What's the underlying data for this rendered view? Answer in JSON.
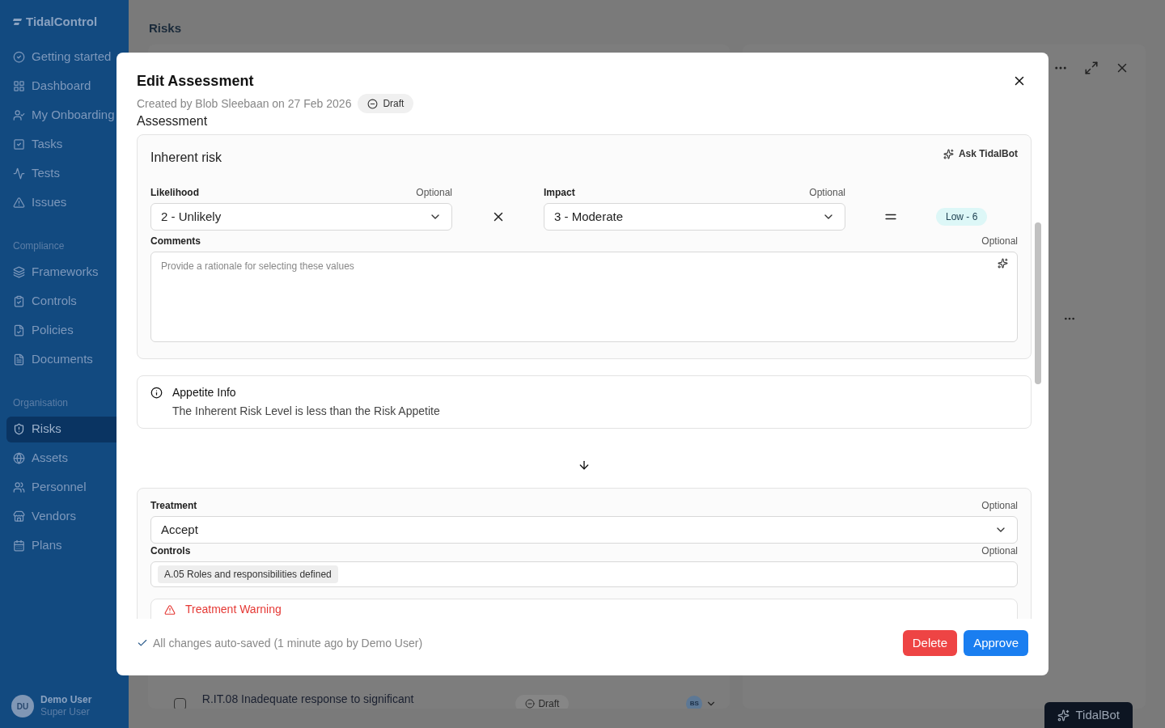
{
  "sidebar": {
    "logo": "TidalControl",
    "groups": [
      {
        "items": [
          {
            "label": "Getting started",
            "selected": false
          },
          {
            "label": "Dashboard",
            "selected": false
          },
          {
            "label": "My Onboarding",
            "selected": false
          },
          {
            "label": "Tasks",
            "selected": false
          },
          {
            "label": "Tests",
            "selected": false
          },
          {
            "label": "Issues",
            "selected": false
          }
        ]
      },
      {
        "heading": "Compliance",
        "items": [
          {
            "label": "Frameworks",
            "selected": false
          },
          {
            "label": "Controls",
            "selected": false
          },
          {
            "label": "Policies",
            "selected": false
          },
          {
            "label": "Documents",
            "selected": false
          }
        ]
      },
      {
        "heading": "Organisation",
        "items": [
          {
            "label": "Risks",
            "selected": true
          },
          {
            "label": "Assets",
            "selected": false
          },
          {
            "label": "Personnel",
            "selected": false
          },
          {
            "label": "Vendors",
            "selected": false
          },
          {
            "label": "Plans",
            "selected": false
          }
        ]
      }
    ],
    "user": {
      "initials": "DU",
      "name": "Demo User",
      "role": "Super User"
    }
  },
  "page": {
    "title": "Risks",
    "row": {
      "checked": false,
      "title": "R.IT.08 Inadequate response to significant",
      "status": "Draft",
      "owner": "BS"
    }
  },
  "tidalbot_button": "TidalBot",
  "modal": {
    "title": "Edit Assessment",
    "meta": "Created by Blob Sleebaan on 27 Feb 2026",
    "status": "Draft",
    "section": "Assessment",
    "inherent": {
      "title": "Inherent risk",
      "ask": "Ask TidalBot",
      "likelihood": {
        "label": "Likelihood",
        "hint": "Optional",
        "value": "2 - Unlikely"
      },
      "impact": {
        "label": "Impact",
        "hint": "Optional",
        "value": "3 - Moderate"
      },
      "result": "Low - 6",
      "comments": {
        "label": "Comments",
        "hint": "Optional",
        "placeholder": "Provide a rationale for selecting these values"
      }
    },
    "appetite": {
      "title": "Appetite Info",
      "text": "The Inherent Risk Level is less than the Risk Appetite"
    },
    "treatment": {
      "label": "Treatment",
      "hint": "Optional",
      "value": "Accept"
    },
    "controls": {
      "label": "Controls",
      "hint": "Optional",
      "tags": [
        "A.05 Roles and responsibilities defined"
      ]
    },
    "warning": "Treatment Warning",
    "autosave": "All changes auto-saved (1 minute ago by Demo User)",
    "buttons": [
      "Delete",
      "Approve"
    ]
  }
}
